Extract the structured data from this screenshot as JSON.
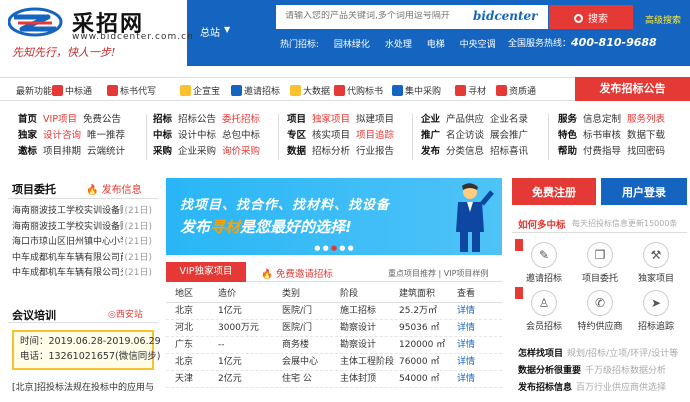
{
  "brand": {
    "name": "采招网",
    "url": "www.bidcenter.com.cn",
    "slogan": "先知先行，快人一步!"
  },
  "header": {
    "region": "总站",
    "search_placeholder": "请输入您的产品关键词,多个词用逗号隔开",
    "search_brand": "bidcenter",
    "search_button": "搜索",
    "advanced_search": "高级搜索",
    "hot_label": "热门招标:",
    "hot_items": [
      "园林绿化",
      "水处理",
      "电梯",
      "中央空调"
    ],
    "hotline_label": "全国服务热线：",
    "hotline_number": "400-810-9688"
  },
  "funcbar": {
    "label": "最新功能:",
    "items": [
      "中标通",
      "标书代写",
      "企宣宝",
      "邀请招标",
      "大数据",
      "代购标书",
      "集中采购",
      "寻材",
      "资质通"
    ],
    "colors": [
      "#e53935",
      "#e53935",
      "#fbc02d",
      "#1565c0",
      "#fbc02d",
      "#e53935",
      "#1565c0",
      "#e53935",
      "#e53935"
    ],
    "post_announcement": "发布招标公告"
  },
  "links": {
    "col1": [
      {
        "h": "首页",
        "items": [
          "VIP项目",
          "免费公告"
        ]
      },
      {
        "h": "独家",
        "items": [
          "设计咨询",
          "唯一推荐"
        ]
      },
      {
        "h": "邀标",
        "items": [
          "项目排期",
          "云端统计"
        ]
      }
    ],
    "col2": [
      {
        "h": "招标",
        "items": [
          "招标公告",
          "委托招标"
        ]
      },
      {
        "h": "中标",
        "items": [
          "设计中标",
          "总包中标"
        ]
      },
      {
        "h": "采购",
        "items": [
          "企业采购",
          "询价采购"
        ]
      }
    ],
    "col3": [
      {
        "h": "项目",
        "items": [
          "独家项目",
          "拟建项目"
        ]
      },
      {
        "h": "专区",
        "items": [
          "核实项目",
          "项目追踪"
        ]
      },
      {
        "h": "数据",
        "items": [
          "招标分析",
          "行业报告"
        ]
      }
    ],
    "col4": [
      {
        "h": "企业",
        "items": [
          "产品供应",
          "企业名录"
        ]
      },
      {
        "h": "推广",
        "items": [
          "名企访谈",
          "展会推广"
        ]
      },
      {
        "h": "发布",
        "items": [
          "分类信息",
          "招标喜讯"
        ]
      }
    ],
    "col5": [
      {
        "h": "服务",
        "items": [
          "信息定制",
          "服务列表"
        ]
      },
      {
        "h": "特色",
        "items": [
          "标书审核",
          "数据下载"
        ]
      },
      {
        "h": "帮助",
        "items": [
          "付费指导",
          "找回密码"
        ]
      }
    ]
  },
  "left": {
    "title": "项目委托",
    "action": "发布信息",
    "projects": [
      {
        "name": "海南丽波技工学校实训设备购",
        "date": "(21日)"
      },
      {
        "name": "海南丽波技工学校实训设备购",
        "date": "(21日)"
      },
      {
        "name": "海口市琼山区旧州镇中心小学",
        "date": "(21日)"
      },
      {
        "name": "中车成都机车车辆有限公司前",
        "date": "(21日)"
      },
      {
        "name": "中车成都机车车辆有限公司头",
        "date": "(21日)"
      }
    ],
    "training_title": "会议培训",
    "training_location": "◎西安站",
    "training_time": "时间：2019.06.28-2019.06.29",
    "training_phone": "电话：13261021657(微信同步)",
    "bottom_text": "[北京]招投标法规在投标中的应用与"
  },
  "banner": {
    "line1": "找项目、找合作、找材料、找设备",
    "line2_a": "发布",
    "line2_b": "寻材",
    "line2_c": "是您最好的选择!"
  },
  "tabs": {
    "vip": "VIP独家项目",
    "free": "免费邀请招标",
    "links": "重点项目推荐 | VIP项目样例"
  },
  "table": {
    "headers": [
      "地区",
      "造价",
      "类别",
      "阶段",
      "建筑面积",
      "查看"
    ],
    "rows": [
      [
        "北京",
        "1亿元",
        "医院/门",
        "施工招标",
        "25.2万㎡",
        "详情"
      ],
      [
        "河北",
        "3000万元",
        "医院/门",
        "勘察设计",
        "95036 ㎡",
        "详情"
      ],
      [
        "广东",
        "--",
        "商务楼",
        "勘察设计",
        "120000 ㎡",
        "详情"
      ],
      [
        "北京",
        "1亿元",
        "会展中心",
        "主体工程阶段",
        "76000 ㎡",
        "详情"
      ],
      [
        "天津",
        "2亿元",
        "住宅 公",
        "主体封顶",
        "54000 ㎡",
        "详情"
      ]
    ]
  },
  "right": {
    "register": "免费注册",
    "login": "用户登录",
    "win_title": "如何多中标",
    "win_sub": "每天招投标信息更新15000条",
    "services": [
      {
        "label": "邀请招标",
        "icon": "✎",
        "icon_name": "invite-icon"
      },
      {
        "label": "项目委托",
        "icon": "❐",
        "icon_name": "document-icon"
      },
      {
        "label": "独家项目",
        "icon": "⚒",
        "icon_name": "hammer-icon"
      },
      {
        "label": "会员招标",
        "icon": "♙",
        "icon_name": "member-icon"
      },
      {
        "label": "特约供应商",
        "icon": "✆",
        "icon_name": "supplier-icon"
      },
      {
        "label": "招标追踪",
        "icon": "➤",
        "icon_name": "track-icon"
      }
    ],
    "links": [
      {
        "b": "怎样找项目",
        "s": "规划/招标/立项/环评/设计等"
      },
      {
        "b": "数据分析很重要",
        "s": "千万级招标数据分析"
      },
      {
        "b": "发布招标信息",
        "s": "百万行业供应商供选择"
      }
    ]
  }
}
